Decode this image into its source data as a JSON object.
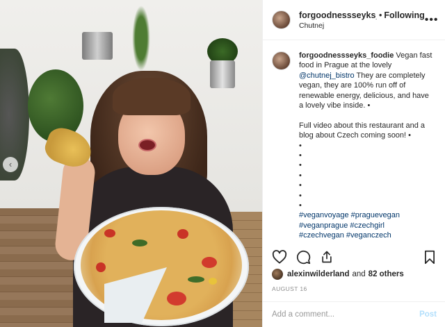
{
  "post": {
    "username": "forgoodnessseyks_foodie",
    "follow_label": "Following",
    "location": "Chutnej",
    "more_icon": "more-horizontal-icon"
  },
  "caption": {
    "username": "forgoodnessseyks_foodie",
    "text_before_mention": "Vegan fast food in Prague at the lovely",
    "mention": "@chutnej_bistro",
    "text_after_mention": "They are completely vegan, they are 100% run off of renewable energy, delicious, and have a lovely vibe inside. •",
    "paragraph2": "Full video about this restaurant and a blog about Czech coming soon! •",
    "bullets": [
      "•",
      "•",
      "•",
      "•",
      "•",
      "•",
      "•"
    ],
    "hashtag_lines": [
      [
        "#veganvoyage",
        "#praguevegan"
      ],
      [
        "#veganprague",
        "#czechgirl"
      ],
      [
        "#czechvegan",
        "#veganczech"
      ]
    ]
  },
  "actions": {
    "like_icon": "heart-icon",
    "comment_icon": "comment-icon",
    "share_icon": "share-icon",
    "save_icon": "bookmark-icon"
  },
  "likes": {
    "liker": "alexinwilderland",
    "others_text": "and",
    "others_count": "82 others"
  },
  "date": "AUGUST 16",
  "comment": {
    "placeholder": "Add a comment...",
    "post_label": "Post"
  },
  "colors": {
    "link": "#003569",
    "post_disabled": "#b2dffc",
    "muted": "#8e8e8e"
  }
}
